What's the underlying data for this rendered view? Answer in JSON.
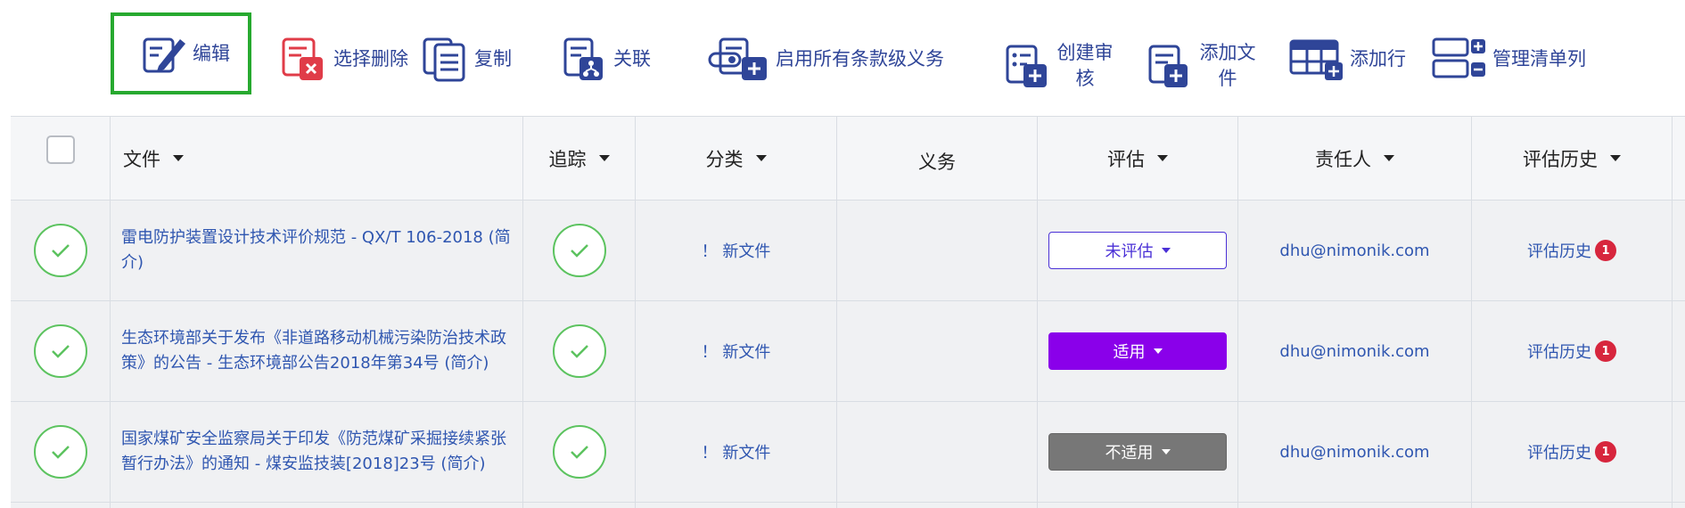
{
  "toolbar": {
    "edit": "编辑",
    "select_delete": "选择删除",
    "copy": "复制",
    "link": "关联",
    "enable_clause": "启用所有条款级义务",
    "create_audit": "创建审核",
    "add_doc": "添加文件",
    "add_row": "添加行",
    "manage_list": "管理清单列"
  },
  "table": {
    "headers": {
      "doc": "文件",
      "track": "追踪",
      "category": "分类",
      "duty": "义务",
      "assess": "评估",
      "owner": "责任人",
      "history": "评估历史"
    },
    "rows": [
      {
        "doc": "雷电防护装置设计技术评价规范 - QX/T 106-2018 (简介)",
        "category": "！ 新文件",
        "assess": "未评估",
        "owner": "dhu@nimonik.com",
        "history": "评估历史",
        "history_count": "1"
      },
      {
        "doc": "生态环境部关于发布《非道路移动机械污染防治技术政策》的公告 - 生态环境部公告2018年第34号 (简介)",
        "category": "！ 新文件",
        "assess": "适用",
        "owner": "dhu@nimonik.com",
        "history": "评估历史",
        "history_count": "1"
      },
      {
        "doc": "国家煤矿安全监察局关于印发《防范煤矿采掘接续紧张暂行办法》的通知 - 煤安监技装[2018]23号 (简介)",
        "category": "！ 新文件",
        "assess": "不适用",
        "owner": "dhu@nimonik.com",
        "history": "评估历史",
        "history_count": "1"
      }
    ]
  },
  "colors": {
    "highlight_border": "#27a92f",
    "link": "#2f56b0",
    "assess_none": "#4a30d6",
    "assess_yes": "#8a00ea",
    "assess_no": "#777777",
    "badge": "#d7263d",
    "check": "#5cc35f"
  }
}
